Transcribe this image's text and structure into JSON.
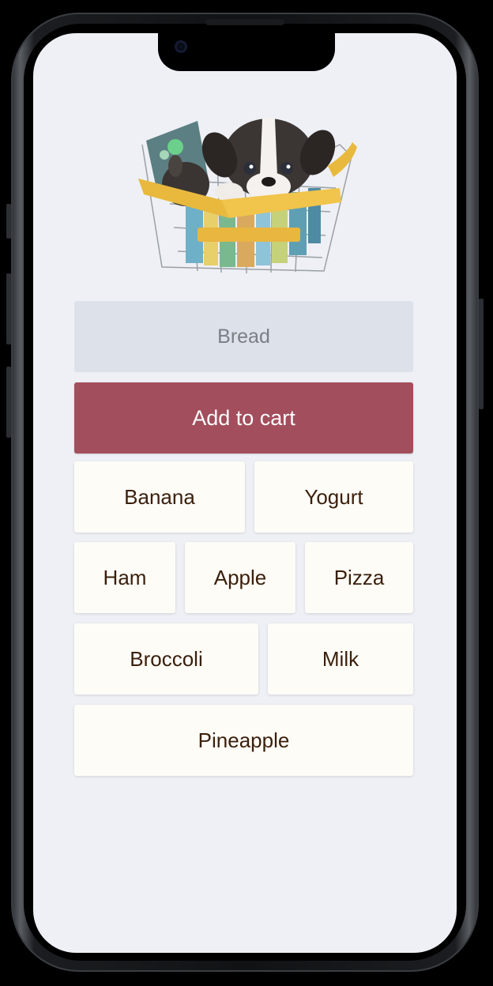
{
  "app": {
    "hero_image": "puppy-in-shopping-basket",
    "input": {
      "value": "Bread"
    },
    "add_button": {
      "label": "Add to cart"
    },
    "items": [
      {
        "label": "Banana"
      },
      {
        "label": "Yogurt"
      },
      {
        "label": "Ham"
      },
      {
        "label": "Apple"
      },
      {
        "label": "Pizza"
      },
      {
        "label": "Broccoli"
      },
      {
        "label": "Milk"
      },
      {
        "label": "Pineapple"
      }
    ]
  },
  "colors": {
    "screen_bg": "#eef0f5",
    "input_bg": "#dde1e9",
    "accent": "#a34e5c",
    "chip_bg": "#fdfcf7",
    "chip_text": "#3a1f0c"
  }
}
